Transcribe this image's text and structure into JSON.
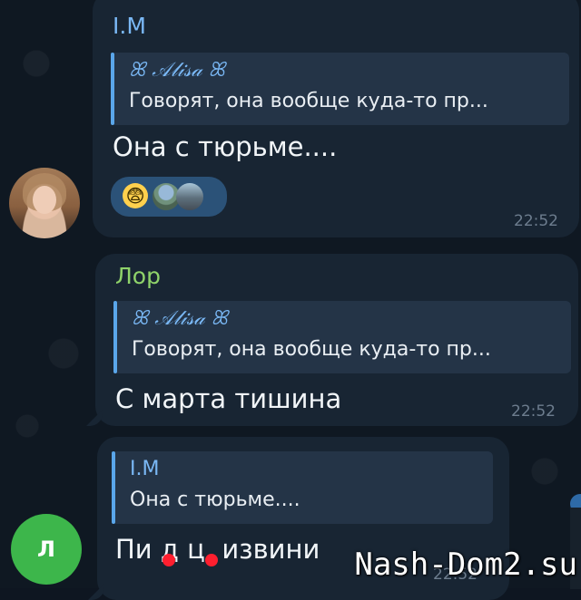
{
  "messages": [
    {
      "sender": "I.M",
      "quote_author": "ꕤ 𝒜𝓁𝒾𝓈𝒶 ꕤ",
      "quote_text": "Говорят, она вообще куда-то пр...",
      "text": "Она с тюрьме....",
      "time": "22:52",
      "reaction_emoji": "😨",
      "avatar": "girl-photo-avatar"
    },
    {
      "sender": "Лор",
      "quote_author": "ꕤ 𝒜𝓁𝒾𝓈𝒶 ꕤ",
      "quote_text": "Говорят, она вообще куда-то пр...",
      "text": "С марта тишина",
      "time": "22:52"
    },
    {
      "quote_author": "I.M",
      "quote_text": "Она с тюрьме....",
      "text": "Пи  д  ц, извини",
      "time": "22:52",
      "avatar_letter": "Л"
    }
  ],
  "watermark": "Nash-Dom2.su",
  "colors": {
    "background": "#0e1621",
    "bubble": "#182533",
    "quote": "#243447",
    "accent_blue": "#7ab8f5",
    "accent_green": "#8fd36a",
    "reaction": "#2b5278",
    "avatar_green": "#3db64b"
  }
}
